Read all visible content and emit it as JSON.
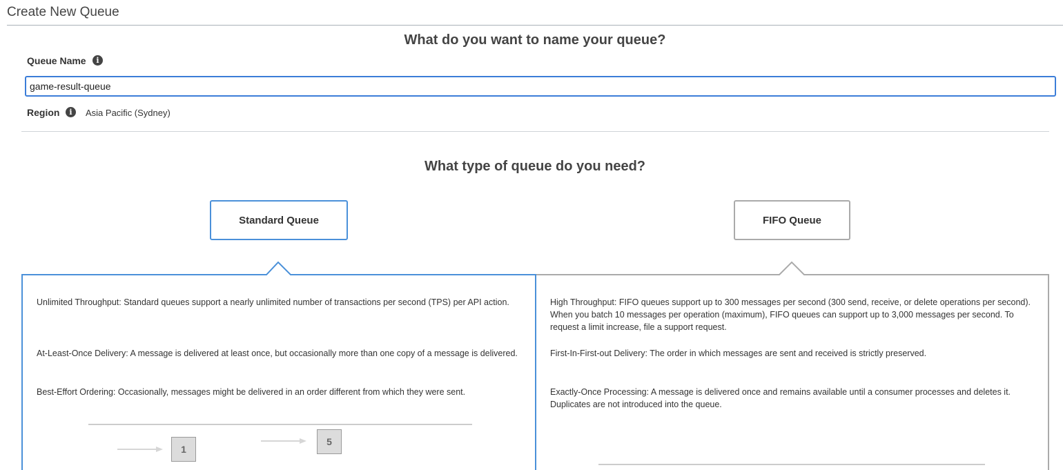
{
  "page": {
    "title": "Create New Queue"
  },
  "name_section": {
    "heading": "What do you want to name your queue?",
    "queue_name_label": "Queue Name",
    "queue_name_value": "game-result-queue",
    "region_label": "Region",
    "region_value": "Asia Pacific (Sydney)"
  },
  "type_section": {
    "heading": "What type of queue do you need?",
    "options": [
      {
        "label": "Standard Queue",
        "selected": true,
        "features": [
          "Unlimited Throughput: Standard queues support a nearly unlimited number of transactions per second (TPS) per API action.",
          "At-Least-Once Delivery: A message is delivered at least once, but occasionally more than one copy of a message is delivered.",
          "Best-Effort Ordering: Occasionally, messages might be delivered in an order different from which they were sent."
        ],
        "diagram_boxes": [
          "1",
          "5"
        ]
      },
      {
        "label": "FIFO Queue",
        "selected": false,
        "features": [
          "High Throughput: FIFO queues support up to 300 messages per second (300 send, receive, or delete operations per second). When you batch 10 messages per operation (maximum), FIFO queues can support up to 3,000 messages per second. To request a limit increase, file a support request.",
          "First-In-First-out Delivery: The order in which messages are sent and received is strictly preserved.",
          "Exactly-Once Processing: A message is delivered once and remains available until a consumer processes and deletes it. Duplicates are not introduced into the queue."
        ]
      }
    ]
  },
  "colors": {
    "selected_border": "#4a90d9",
    "unselected_border": "#aaaaaa",
    "input_focus_border": "#3b7dd8"
  },
  "icons": {
    "info": "info-icon",
    "arrow": "arrow-right-icon"
  }
}
